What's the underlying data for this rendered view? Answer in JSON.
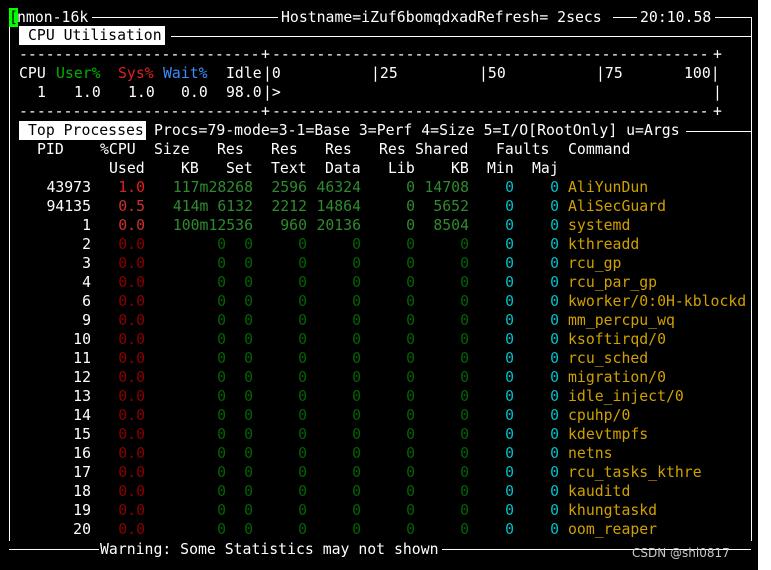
{
  "header": {
    "cursor_char": "[",
    "app_title": "nmon-16k",
    "hostname_refresh": "Hostname=iZuf6bomqdxadRefresh= 2secs",
    "time": "20:10.58"
  },
  "cpu_section": {
    "title": "CPU Utilisation",
    "dashes_left": "---------------------------",
    "plus": "+",
    "dashes_right": "-------------------------------------------------",
    "labels": {
      "cpu": "CPU",
      "user": "User%",
      "sys": "Sys%",
      "wait": "Wait%",
      "idle": "Idle"
    },
    "scale": {
      "s0": "|0",
      "s25": "|25",
      "s50": "|50",
      "s75": "|75",
      "s100": "100|"
    },
    "row": {
      "cpu": "1",
      "user": "1.0",
      "sys": "1.0",
      "wait": "0.0",
      "idle": "98.0",
      "bar": "|>",
      "bar_end": "|"
    }
  },
  "top_processes": {
    "title": "Top Processes",
    "info": "Procs=79-mode=3-1=Base 3=Perf 4=Size 5=I/O[RootOnly] u=Args",
    "headers1": {
      "pid": "PID",
      "cpu": "%CPU",
      "size": "Size",
      "res": "Res",
      "res_text": "Res",
      "res_data": "Res",
      "res_lib": "Res",
      "shared": "Shared",
      "faults": "Faults",
      "command": "Command"
    },
    "headers2": {
      "cpu": "Used",
      "size": "KB",
      "res": "Set",
      "text": "Text",
      "data": "Data",
      "lib": "Lib",
      "shared": "KB",
      "min": "Min",
      "maj": "Maj"
    },
    "rows": [
      {
        "pid": "43973",
        "cpu": "1.0",
        "sizeres": "117m28268",
        "text": "2596",
        "data": "46324",
        "lib": "0",
        "shared": "14708",
        "min": "0",
        "maj": "0",
        "command": "AliYunDun"
      },
      {
        "pid": "94135",
        "cpu": "0.5",
        "sizeres": "414m 6132",
        "text": "2212",
        "data": "14864",
        "lib": "0",
        "shared": "5652",
        "min": "0",
        "maj": "0",
        "command": "AliSecGuard"
      },
      {
        "pid": "1",
        "cpu": "0.0",
        "sizeres": "100m12536",
        "text": "960",
        "data": "20136",
        "lib": "0",
        "shared": "8504",
        "min": "0",
        "maj": "0",
        "command": "systemd"
      },
      {
        "pid": "2",
        "cpu": "0.0",
        "size": "0",
        "res": "0",
        "text": "0",
        "data": "0",
        "lib": "0",
        "shared": "0",
        "min": "0",
        "maj": "0",
        "command": "kthreadd"
      },
      {
        "pid": "3",
        "cpu": "0.0",
        "size": "0",
        "res": "0",
        "text": "0",
        "data": "0",
        "lib": "0",
        "shared": "0",
        "min": "0",
        "maj": "0",
        "command": "rcu_gp"
      },
      {
        "pid": "4",
        "cpu": "0.0",
        "size": "0",
        "res": "0",
        "text": "0",
        "data": "0",
        "lib": "0",
        "shared": "0",
        "min": "0",
        "maj": "0",
        "command": "rcu_par_gp"
      },
      {
        "pid": "6",
        "cpu": "0.0",
        "size": "0",
        "res": "0",
        "text": "0",
        "data": "0",
        "lib": "0",
        "shared": "0",
        "min": "0",
        "maj": "0",
        "command": "kworker/0:0H-kblockd"
      },
      {
        "pid": "9",
        "cpu": "0.0",
        "size": "0",
        "res": "0",
        "text": "0",
        "data": "0",
        "lib": "0",
        "shared": "0",
        "min": "0",
        "maj": "0",
        "command": "mm_percpu_wq"
      },
      {
        "pid": "10",
        "cpu": "0.0",
        "size": "0",
        "res": "0",
        "text": "0",
        "data": "0",
        "lib": "0",
        "shared": "0",
        "min": "0",
        "maj": "0",
        "command": "ksoftirqd/0"
      },
      {
        "pid": "11",
        "cpu": "0.0",
        "size": "0",
        "res": "0",
        "text": "0",
        "data": "0",
        "lib": "0",
        "shared": "0",
        "min": "0",
        "maj": "0",
        "command": "rcu_sched"
      },
      {
        "pid": "12",
        "cpu": "0.0",
        "size": "0",
        "res": "0",
        "text": "0",
        "data": "0",
        "lib": "0",
        "shared": "0",
        "min": "0",
        "maj": "0",
        "command": "migration/0"
      },
      {
        "pid": "13",
        "cpu": "0.0",
        "size": "0",
        "res": "0",
        "text": "0",
        "data": "0",
        "lib": "0",
        "shared": "0",
        "min": "0",
        "maj": "0",
        "command": "idle_inject/0"
      },
      {
        "pid": "14",
        "cpu": "0.0",
        "size": "0",
        "res": "0",
        "text": "0",
        "data": "0",
        "lib": "0",
        "shared": "0",
        "min": "0",
        "maj": "0",
        "command": "cpuhp/0"
      },
      {
        "pid": "15",
        "cpu": "0.0",
        "size": "0",
        "res": "0",
        "text": "0",
        "data": "0",
        "lib": "0",
        "shared": "0",
        "min": "0",
        "maj": "0",
        "command": "kdevtmpfs"
      },
      {
        "pid": "16",
        "cpu": "0.0",
        "size": "0",
        "res": "0",
        "text": "0",
        "data": "0",
        "lib": "0",
        "shared": "0",
        "min": "0",
        "maj": "0",
        "command": "netns"
      },
      {
        "pid": "17",
        "cpu": "0.0",
        "size": "0",
        "res": "0",
        "text": "0",
        "data": "0",
        "lib": "0",
        "shared": "0",
        "min": "0",
        "maj": "0",
        "command": "rcu_tasks_kthre"
      },
      {
        "pid": "18",
        "cpu": "0.0",
        "size": "0",
        "res": "0",
        "text": "0",
        "data": "0",
        "lib": "0",
        "shared": "0",
        "min": "0",
        "maj": "0",
        "command": "kauditd"
      },
      {
        "pid": "19",
        "cpu": "0.0",
        "size": "0",
        "res": "0",
        "text": "0",
        "data": "0",
        "lib": "0",
        "shared": "0",
        "min": "0",
        "maj": "0",
        "command": "khungtaskd"
      },
      {
        "pid": "20",
        "cpu": "0.0",
        "size": "0",
        "res": "0",
        "text": "0",
        "data": "0",
        "lib": "0",
        "shared": "0",
        "min": "0",
        "maj": "0",
        "command": "oom_reaper"
      }
    ]
  },
  "footer": {
    "warning": "Warning: Some Statistics may not shown"
  },
  "watermark": "CSDN @shl0817",
  "colors": {
    "background": "#000000",
    "foreground": "#ffffff",
    "user": "#00b000",
    "sys": "#e02020",
    "wait": "#3a8cff",
    "cpu_used": "#8b0000",
    "memory": "#006400",
    "faults": "#00c0c8",
    "command": "#d0a000"
  }
}
